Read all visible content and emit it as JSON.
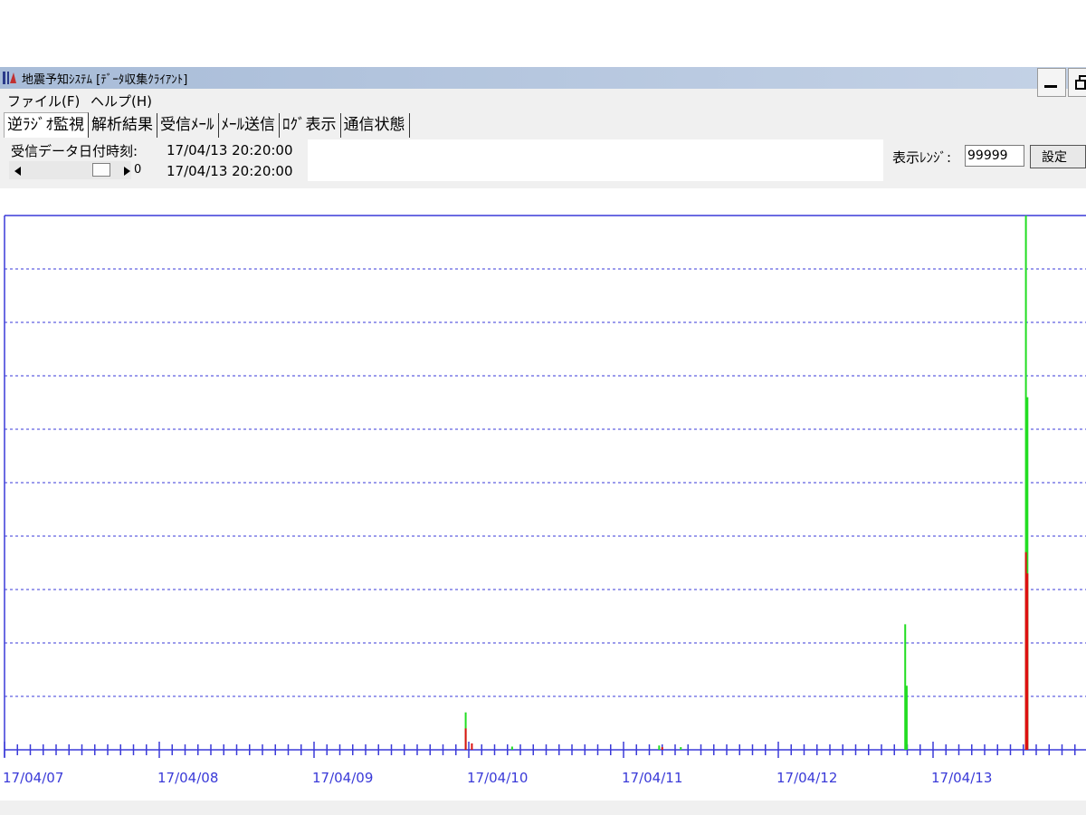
{
  "window": {
    "title": "地震予知ｼｽﾃﾑ [ﾃﾞｰﾀ収集ｸﾗｲｱﾝﾄ]",
    "minimize_icon": "minimize-icon",
    "maximize_icon": "restore-icon"
  },
  "menu": [
    {
      "label": "ファイル(F)"
    },
    {
      "label": "ヘルプ(H)"
    }
  ],
  "tabs": [
    {
      "label": "逆ﾗｼﾞｵ監視"
    },
    {
      "label": "解析結果"
    },
    {
      "label": "受信ﾒｰﾙ"
    },
    {
      "label": "ﾒｰﾙ送信"
    },
    {
      "label": "ﾛｸﾞ表示"
    },
    {
      "label": "通信状態"
    }
  ],
  "info": {
    "received_label": "受信データ日付時刻:",
    "received_time": "17/04/13 20:20:00",
    "slider_time": "17/04/13 20:20:00",
    "slider_value": "0"
  },
  "range": {
    "label": "表示ﾚﾝｼﾞ:",
    "value": "99999",
    "set_button": "設定"
  },
  "colors": {
    "axis": "#3a3ad8",
    "grid": "#3a3ad8",
    "series_green": "#22dd22",
    "series_red": "#dd1111"
  },
  "chart_data": {
    "type": "bar",
    "x_labels": [
      "17/04/07",
      "17/04/08",
      "17/04/09",
      "17/04/10",
      "17/04/11",
      "17/04/12",
      "17/04/13"
    ],
    "x_range": [
      0,
      7
    ],
    "y_range": [
      0,
      99999
    ],
    "grid": "horizontal dashed",
    "series": [
      {
        "color": "green",
        "points": [
          {
            "x": 2.98,
            "y": 7000
          },
          {
            "x": 3.28,
            "y": 600
          },
          {
            "x": 4.23,
            "y": 800
          },
          {
            "x": 4.37,
            "y": 500
          },
          {
            "x": 5.82,
            "y": 23500
          },
          {
            "x": 5.83,
            "y": 12000
          },
          {
            "x": 6.6,
            "y": 99999
          },
          {
            "x": 6.61,
            "y": 66000
          }
        ]
      },
      {
        "color": "red",
        "points": [
          {
            "x": 2.98,
            "y": 4000
          },
          {
            "x": 3.02,
            "y": 1200
          },
          {
            "x": 4.25,
            "y": 500
          },
          {
            "x": 6.6,
            "y": 37000
          },
          {
            "x": 6.61,
            "y": 33000
          }
        ]
      }
    ]
  }
}
